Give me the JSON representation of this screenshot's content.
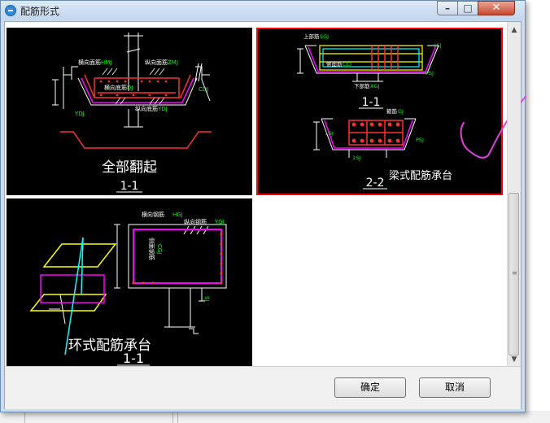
{
  "window": {
    "title": "配筋形式"
  },
  "options": [
    {
      "caption": "全部翻起",
      "section": "1-1",
      "labels": [
        "横向面筋",
        "HMJ",
        "纵向面筋",
        "ZMJ",
        "横向底筋",
        "DJ",
        "纵向底筋",
        "YDJ",
        "CDJ",
        "YDJ"
      ]
    },
    {
      "caption": "梁式配筋承台",
      "section1": "1-1",
      "section2": "2-2",
      "labels": [
        "上部筋",
        "SGJ",
        "侧面筋",
        "CCJ",
        "下部筋",
        "XGJ",
        "箍筋",
        "GJ",
        "PSJ",
        "1SJ",
        "1SJ",
        "PSJ",
        "LSJ"
      ]
    },
    {
      "caption": "环式配筋承台",
      "section": "1-1",
      "labels": [
        "横向钢筋",
        "HGJ",
        "纵向钢筋",
        "YGJ",
        "侧面钢筋",
        "CGJ",
        "SJ"
      ]
    }
  ],
  "buttons": {
    "ok": "确定",
    "cancel": "取消"
  },
  "colors": {
    "cad_background": "#000000",
    "selection_border": "#ff0000",
    "annotation_pen": "#e040e0"
  }
}
